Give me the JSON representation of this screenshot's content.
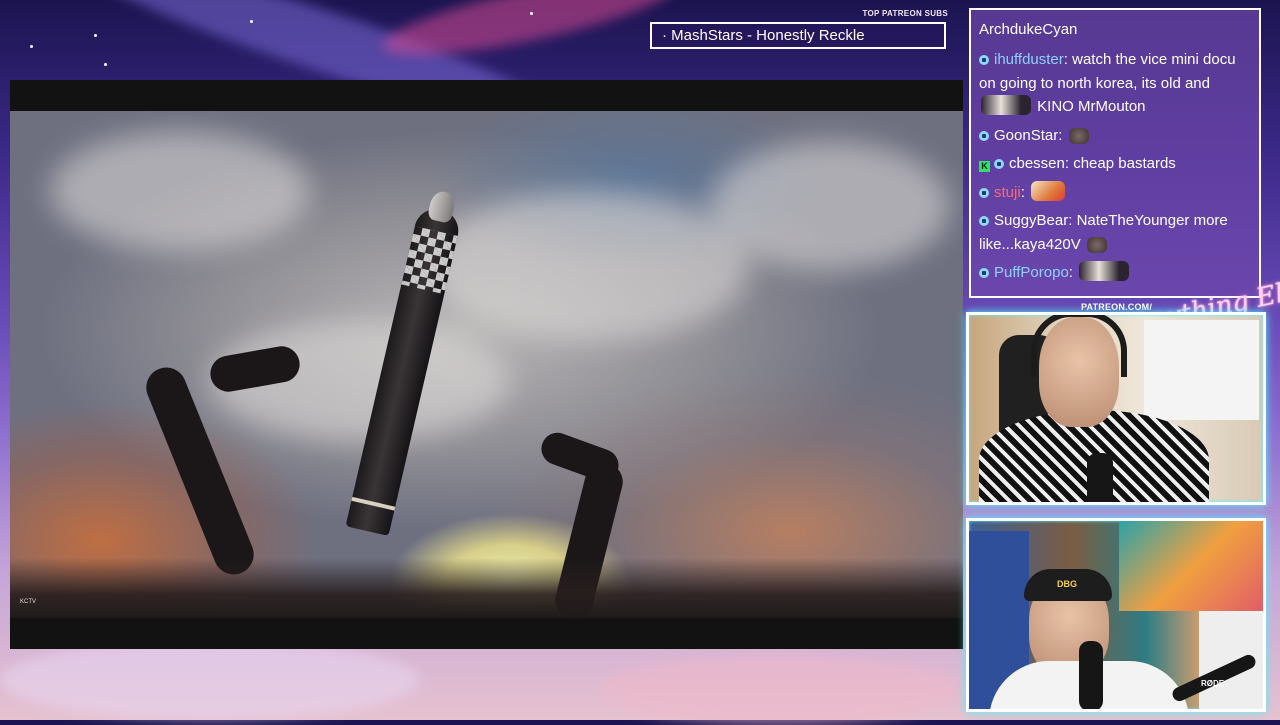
{
  "overlay": {
    "sub_ticker_label": "TOP PATREON SUBS",
    "sub_ticker_text": "· MashStars - Honestly Reckle",
    "patreon_label": "PATREON.COM/",
    "brand_logo": "Anything Else?"
  },
  "video": {
    "watermark": "KCTV"
  },
  "chat": {
    "header_user": "ArchdukeCyan",
    "messages": [
      {
        "badge": "sub",
        "user": "ihuffduster",
        "user_color": "#8fd0ff",
        "sep": ": ",
        "text": "watch the vice mini docu on going to north korea, its old and ",
        "emote_after": "wide",
        "text2": " KINO MrMouton"
      },
      {
        "badge": "sub",
        "user": "GoonStar",
        "user_color": "#ffffff",
        "sep": ": ",
        "text": "",
        "emote_after": "small",
        "text2": ""
      },
      {
        "badge": "k",
        "user": "cbessen",
        "user_color": "#ffffff",
        "sep": ": ",
        "text": "cheap bastards",
        "emote_after": "",
        "text2": ""
      },
      {
        "badge": "sub",
        "user": "stuji",
        "user_color": "#ff6a6a",
        "sep": ": ",
        "text": "",
        "emote_after": "food",
        "text2": ""
      },
      {
        "badge": "sub",
        "user": "SuggyBear",
        "user_color": "#ffffff",
        "sep": ": ",
        "text": "NateTheYounger more like...kaya420V ",
        "emote_after": "small",
        "text2": ""
      },
      {
        "badge": "sub",
        "user": "PuffPoropo",
        "user_color": "#8fd0ff",
        "sep": ": ",
        "text": "",
        "emote_after": "wide",
        "text2": ""
      }
    ]
  },
  "cams": {
    "cam1_name": "streamer-webcam",
    "cam2_name": "guest-webcam",
    "cam2_cap_text": "DBG",
    "cam2_mic_text": "RØDE"
  },
  "colors": {
    "chat_bg": "#6e46aa",
    "cam_glow": "#4ff4ff",
    "ticker_border": "#ffffff"
  }
}
